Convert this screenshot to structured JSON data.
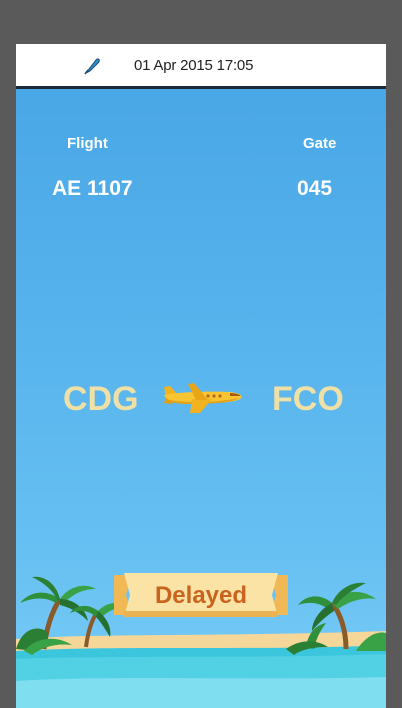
{
  "status_bar": {
    "datetime": "01 Apr 2015 17:05",
    "icon": "feather-pen-icon"
  },
  "flight": {
    "flight_label": "Flight",
    "flight_number": "AE 1107",
    "gate_label": "Gate",
    "gate_number": "045",
    "origin": "CDG",
    "destination": "FCO",
    "status": "Delayed"
  },
  "colors": {
    "sky": "#4aa7e6",
    "airport_text": "#efe0a6",
    "status_text": "#c8641e",
    "banner": "#fbe3a6"
  }
}
